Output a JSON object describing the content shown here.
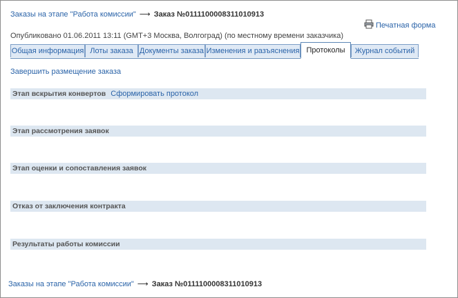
{
  "breadcrumb": {
    "link_text": "Заказы на этапе \"Работа комиссии\"",
    "arrow": "⟶",
    "order_text": "Заказ №0111100008311010913"
  },
  "print_form": {
    "label": "Печатная форма",
    "icon": "printer-icon"
  },
  "published": "Опубликовано 01.06.2011 13:11 (GMT+3 Москва, Волгоград) (по местному времени заказчика)",
  "tabs": [
    {
      "label": "Общая информация",
      "active": false
    },
    {
      "label": "Лоты заказа",
      "active": false
    },
    {
      "label": "Документы заказа",
      "active": false
    },
    {
      "label": "Изменения и разъяснения",
      "active": false
    },
    {
      "label": "Протоколы",
      "active": true
    },
    {
      "label": "Журнал событий",
      "active": false
    }
  ],
  "finish_link": "Завершить размещение заказа",
  "stages": [
    {
      "title": "Этап вскрытия конвертов",
      "action": "Сформировать протокол"
    },
    {
      "title": "Этап рассмотрения заявок"
    },
    {
      "title": "Этап оценки и сопоставления заявок"
    },
    {
      "title": "Отказ от заключения контракта"
    },
    {
      "title": "Результаты работы комиссии"
    }
  ],
  "colors": {
    "link": "#2a63a8",
    "tab_bg": "#dfe9f5",
    "tab_border": "#7a9cc6",
    "stage_bg": "#dde7f1"
  }
}
